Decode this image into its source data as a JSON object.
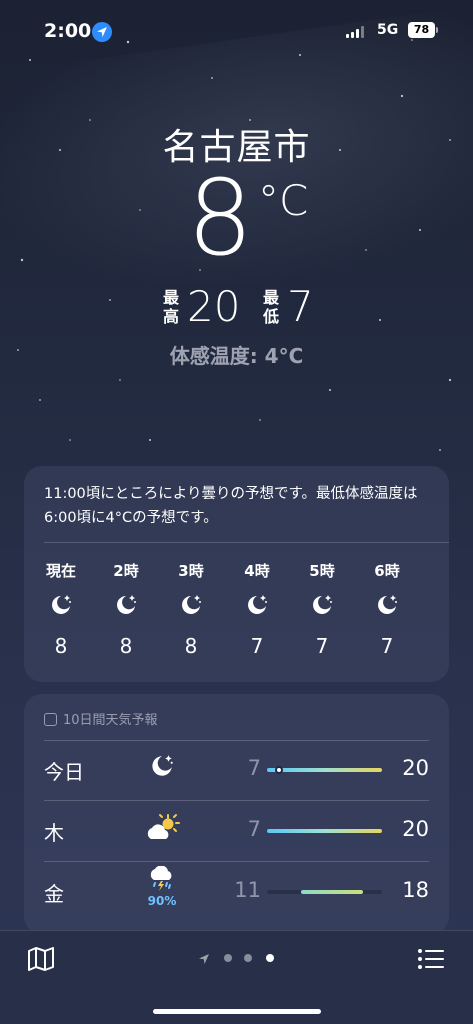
{
  "status_bar": {
    "time": "2:00",
    "network": "5G",
    "battery": "78"
  },
  "location": {
    "city": "名古屋市",
    "temperature": "8",
    "unit": "°C",
    "high_label": "最高",
    "high": "20",
    "low_label": "最低",
    "low": "7",
    "feels_like": "体感温度: 4°C"
  },
  "hourly_card": {
    "summary": "11:00頃にところにより曇りの予想です。最低体感温度は6:00頃に4°Cの予想です。",
    "hours": [
      {
        "label": "現在",
        "icon": "moon-stars-icon",
        "temp": "8"
      },
      {
        "label": "2時",
        "icon": "moon-stars-icon",
        "temp": "8"
      },
      {
        "label": "3時",
        "icon": "moon-stars-icon",
        "temp": "8"
      },
      {
        "label": "4時",
        "icon": "moon-stars-icon",
        "temp": "7"
      },
      {
        "label": "5時",
        "icon": "moon-stars-icon",
        "temp": "7"
      },
      {
        "label": "6時",
        "icon": "moon-stars-icon",
        "temp": "7"
      }
    ]
  },
  "daily_card": {
    "header": "10日間天気予報",
    "days": [
      {
        "day": "今日",
        "icon": "moon-stars-icon",
        "low": "7",
        "high": "20",
        "precip": ""
      },
      {
        "day": "木",
        "icon": "partly-cloudy-sun-icon",
        "low": "7",
        "high": "20",
        "precip": ""
      },
      {
        "day": "金",
        "icon": "thunderstorm-rain-icon",
        "low": "11",
        "high": "18",
        "precip": "90%"
      }
    ]
  },
  "colors": {
    "bar_cool": "#5ac8f5",
    "bar_warm": "#e6d65c",
    "precip_blue": "#6fc2ff"
  }
}
